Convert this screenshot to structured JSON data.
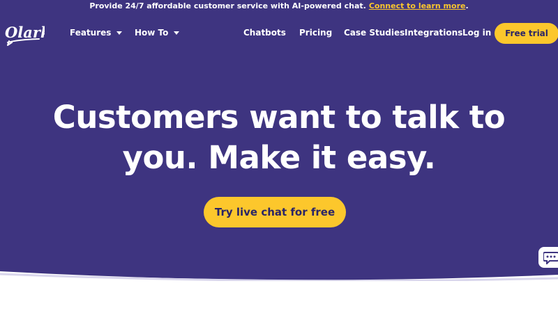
{
  "announcement": {
    "text": "Provide 24/7 affordable customer service with AI-powered chat.",
    "link": "Connect to learn more",
    "suffix": "."
  },
  "brand": {
    "logo_text": "Olark"
  },
  "nav": {
    "features": "Features",
    "how_to": "How To",
    "chatbots": "Chatbots",
    "pricing": "Pricing",
    "case_studies": "Case Studies",
    "integrations": "Integrations",
    "login": "Log in",
    "free_trial": "Free trial"
  },
  "hero": {
    "line1": "Customers want to talk to",
    "line2": "you. Make it easy.",
    "cta": "Try live chat for free"
  },
  "colors": {
    "background": "#3e3480",
    "accent": "#fcc72c",
    "button_text": "#2b2566",
    "text": "#ffffff"
  },
  "icons": {
    "logo": "olark-logo",
    "chat_widget": "chat-bubble-icon"
  }
}
